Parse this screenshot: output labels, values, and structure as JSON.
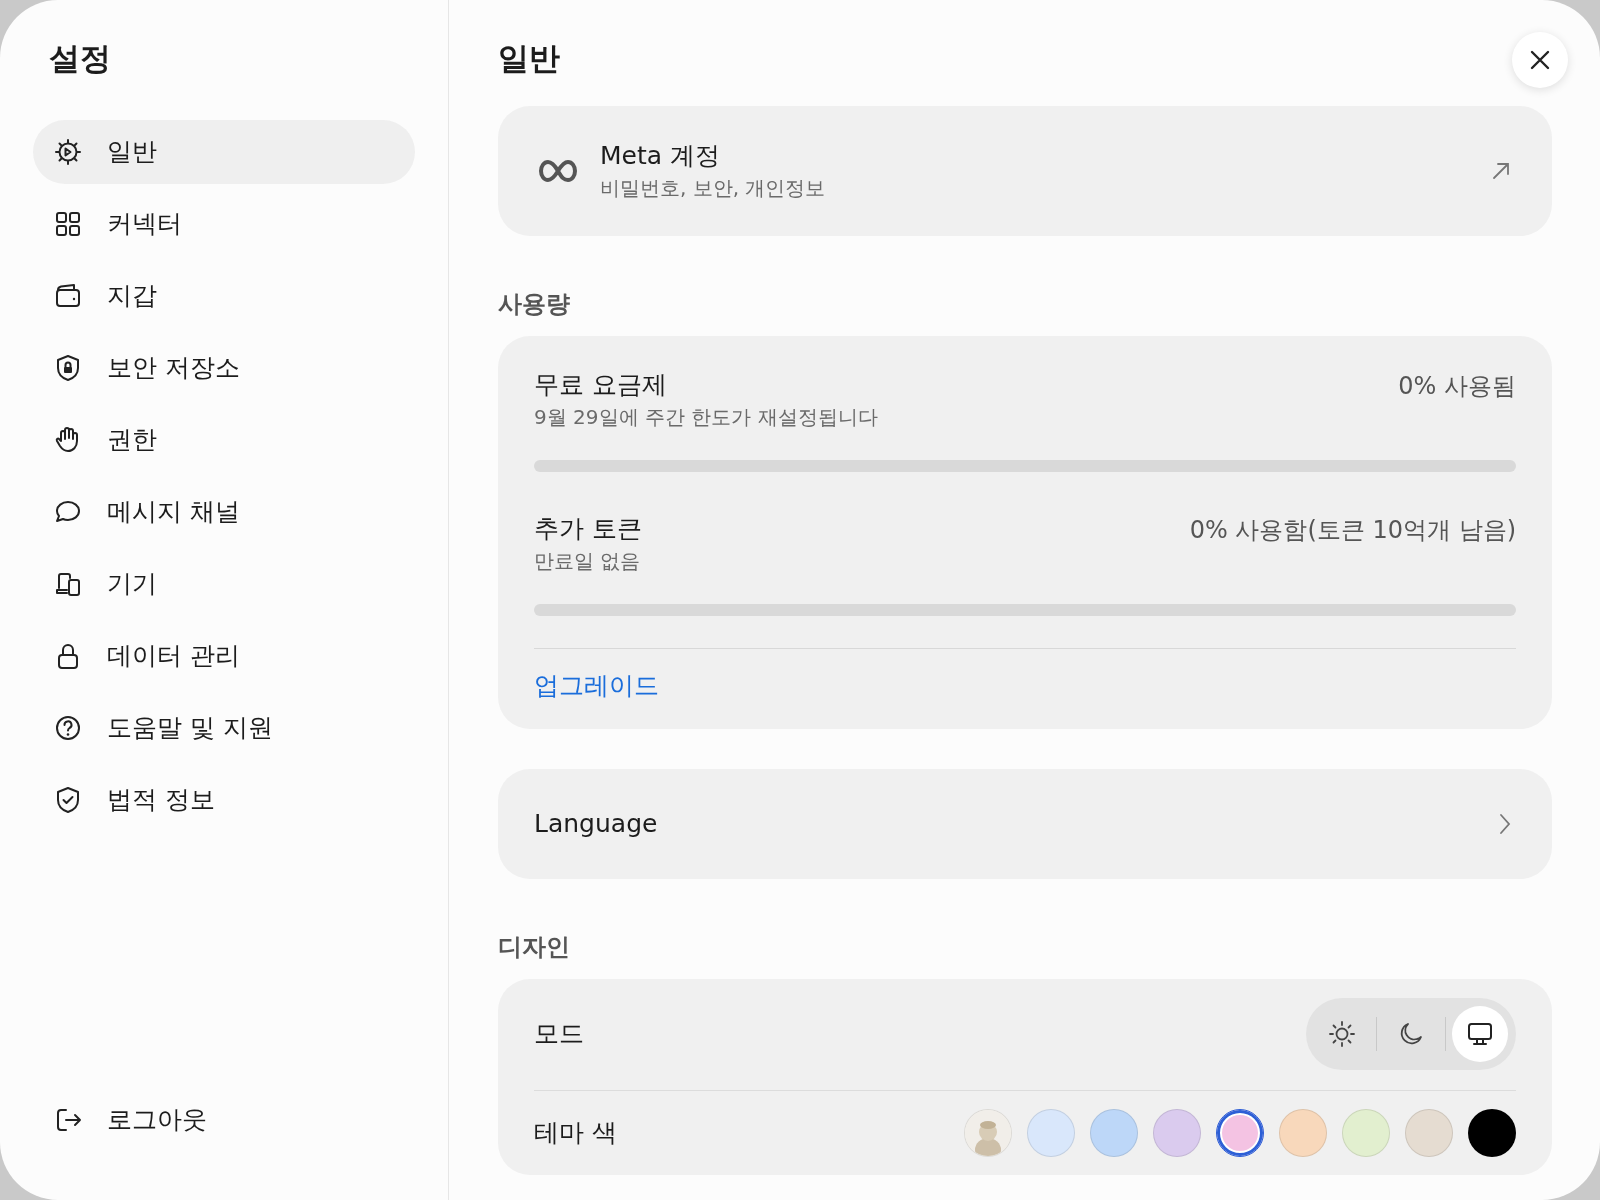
{
  "sidebar": {
    "title": "설정",
    "items": [
      {
        "label": "일반",
        "selected": true
      },
      {
        "label": "커넥터",
        "selected": false
      },
      {
        "label": "지갑",
        "selected": false
      },
      {
        "label": "보안 저장소",
        "selected": false
      },
      {
        "label": "권한",
        "selected": false
      },
      {
        "label": "메시지 채널",
        "selected": false
      },
      {
        "label": "기기",
        "selected": false
      },
      {
        "label": "데이터 관리",
        "selected": false
      },
      {
        "label": "도움말 및 지원",
        "selected": false
      },
      {
        "label": "법적 정보",
        "selected": false
      }
    ],
    "logout": "로그아웃"
  },
  "main": {
    "title": "일반",
    "account": {
      "title": "Meta 계정",
      "subtitle": "비밀번호, 보안, 개인정보"
    },
    "usage": {
      "heading": "사용량",
      "plans": [
        {
          "name": "무료 요금제",
          "note": "9월 29일에 주간 한도가 재설정됩니다",
          "reading": "0% 사용됨",
          "level": 0
        },
        {
          "name": "추가 토큰",
          "note": "만료일 없음",
          "reading": "0% 사용함(토큰 10억개 남음)",
          "level": 0
        }
      ],
      "link": "업그레이드"
    },
    "language": {
      "label": "Language"
    },
    "design": {
      "heading": "디자인",
      "mode": {
        "label": "모드",
        "options": [
          {
            "kind": "light",
            "selected": false
          },
          {
            "kind": "dark",
            "selected": false
          },
          {
            "kind": "system",
            "selected": true
          }
        ]
      },
      "theme": {
        "label": "테마 색",
        "swatches": [
          {
            "kind": "picture",
            "selected": false
          },
          {
            "kind": "color",
            "color": "#d9e7fb",
            "selected": false
          },
          {
            "kind": "color",
            "color": "#bdd7f8",
            "selected": false
          },
          {
            "kind": "color",
            "color": "#dacbee",
            "selected": false
          },
          {
            "kind": "color",
            "color": "#f4c3e3",
            "selected": true
          },
          {
            "kind": "color",
            "color": "#f8d8bb",
            "selected": false
          },
          {
            "kind": "color",
            "color": "#e2efcf",
            "selected": false
          },
          {
            "kind": "color",
            "color": "#e5dcd1",
            "selected": false
          },
          {
            "kind": "color",
            "color": "#000000",
            "selected": false
          }
        ]
      }
    }
  }
}
